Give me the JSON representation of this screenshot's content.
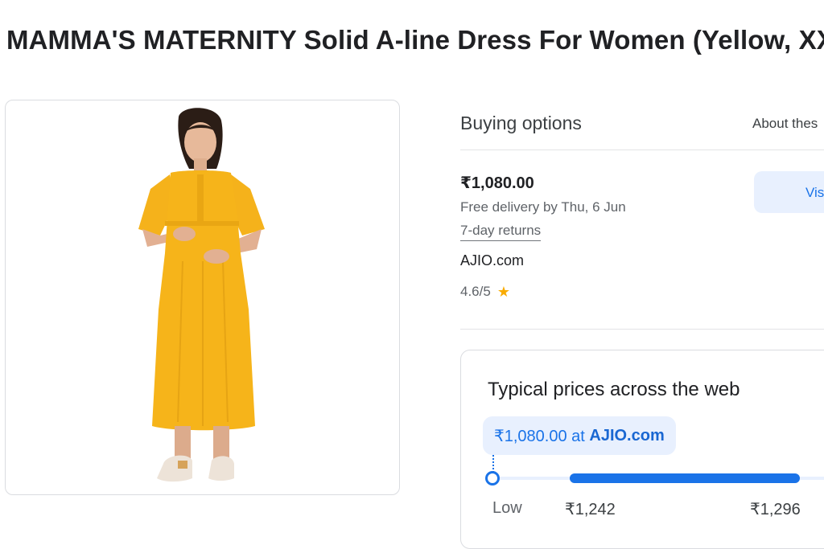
{
  "product": {
    "title": "MAMMA'S MATERNITY Solid A-line Dress For Women (Yellow, XX"
  },
  "buying_options": {
    "header": "Buying options",
    "about_link": "About thes"
  },
  "offer": {
    "price": "₹1,080.00",
    "delivery": "Free delivery by Thu, 6 Jun",
    "returns": "7-day returns",
    "seller": "AJIO.com",
    "rating": "4.6/5",
    "visit_label": "Vis"
  },
  "typical_prices": {
    "title": "Typical prices across the web",
    "chip_prefix": "₹1,080.00 at",
    "chip_seller": "AJIO.com",
    "low_label": "Low",
    "range_low": "₹1,242",
    "range_high": "₹1,296"
  },
  "colors": {
    "accent": "#1a73e8",
    "chip_bg": "#e8f0fe",
    "star": "#f9ab00",
    "dress": "#f6b41a"
  },
  "icons": {
    "rating": "star-icon"
  }
}
